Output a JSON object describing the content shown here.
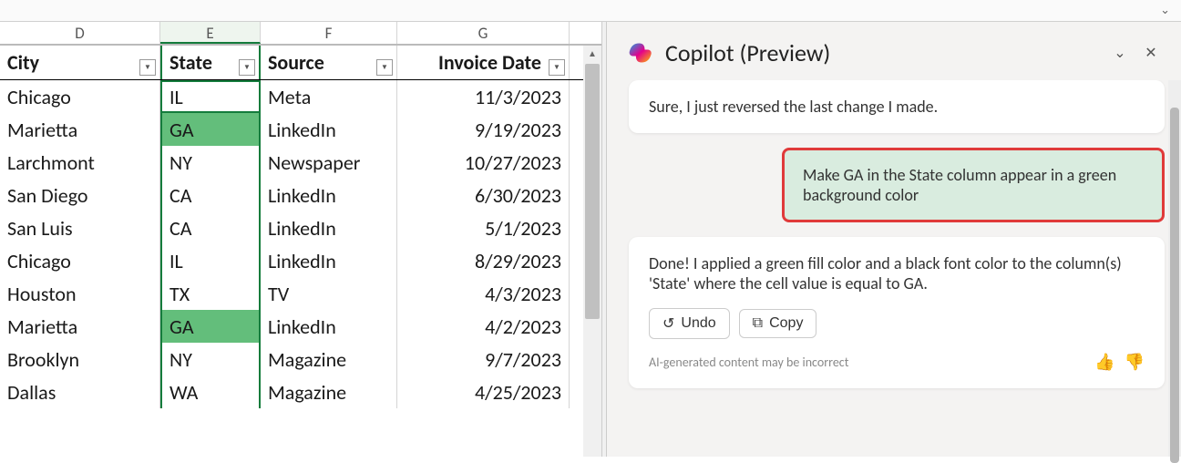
{
  "topbar": {},
  "grid": {
    "col_letters": [
      "D",
      "E",
      "F",
      "G"
    ],
    "selected_col": "E",
    "headers": {
      "D": "City",
      "E": "State",
      "F": "Source",
      "G": "Invoice Date"
    },
    "highlight_state": "GA",
    "active_cell": {
      "row": 0,
      "col": "E"
    },
    "rows": [
      {
        "D": "Chicago",
        "E": "IL",
        "F": "Meta",
        "G": "11/3/2023"
      },
      {
        "D": "Marietta",
        "E": "GA",
        "F": "LinkedIn",
        "G": "9/19/2023"
      },
      {
        "D": "Larchmont",
        "E": "NY",
        "F": "Newspaper",
        "G": "10/27/2023"
      },
      {
        "D": "San Diego",
        "E": "CA",
        "F": "LinkedIn",
        "G": "6/30/2023"
      },
      {
        "D": "San Luis",
        "E": "CA",
        "F": "LinkedIn",
        "G": "5/1/2023"
      },
      {
        "D": "Chicago",
        "E": "IL",
        "F": "LinkedIn",
        "G": "8/29/2023"
      },
      {
        "D": "Houston",
        "E": "TX",
        "F": "TV",
        "G": "4/3/2023"
      },
      {
        "D": "Marietta",
        "E": "GA",
        "F": "LinkedIn",
        "G": "4/2/2023"
      },
      {
        "D": "Brooklyn",
        "E": "NY",
        "F": "Magazine",
        "G": "9/7/2023"
      },
      {
        "D": "Dallas",
        "E": "WA",
        "F": "Magazine",
        "G": "4/25/2023"
      }
    ]
  },
  "copilot": {
    "title": "Copilot (Preview)",
    "msg1": "Sure, I just reversed the last change I made.",
    "user_prompt": "Make GA in the State column appear in a green background color",
    "msg2": "Done! I applied a green fill color and a black font color to the column(s) 'State' where the cell value is equal to GA.",
    "undo_label": "Undo",
    "copy_label": "Copy",
    "disclaimer": "AI-generated content may be incorrect"
  }
}
